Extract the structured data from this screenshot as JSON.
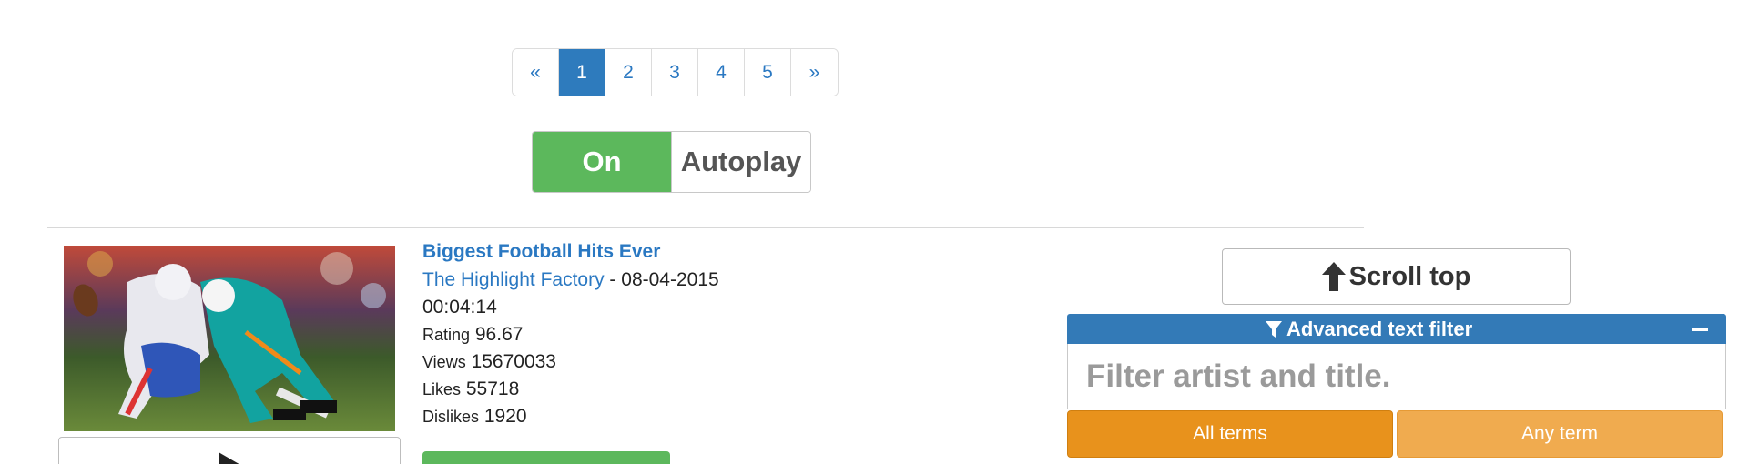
{
  "pagination": {
    "prev": "«",
    "pages": [
      "1",
      "2",
      "3",
      "4",
      "5"
    ],
    "next": "»",
    "active_page": "1"
  },
  "autoplay": {
    "state_label": "On",
    "label": "Autoplay"
  },
  "video": {
    "title": "Biggest Football Hits Ever",
    "channel": "The Highlight Factory",
    "date_sep": " - ",
    "date": "08-04-2015",
    "duration": "00:04:14",
    "rating_label": "Rating",
    "rating": "96.67",
    "views_label": "Views",
    "views": "15670033",
    "likes_label": "Likes",
    "likes": "55718",
    "dislikes_label": "Dislikes",
    "dislikes": "1920",
    "thumbnail_icon": "football-tackle-thumbnail"
  },
  "right_panel": {
    "scroll_top_label": "Scroll top",
    "filter_title": "Advanced text filter",
    "filter_placeholder": "Filter artist and title.",
    "filter_value": "",
    "all_terms_label": "All terms",
    "any_term_label": "Any term"
  },
  "colors": {
    "accent_blue": "#337ab7",
    "active_page": "#2e7bbd",
    "toggle_on": "#5cb85c",
    "all_terms": "#e8921c",
    "any_term": "#f0ab4f"
  }
}
